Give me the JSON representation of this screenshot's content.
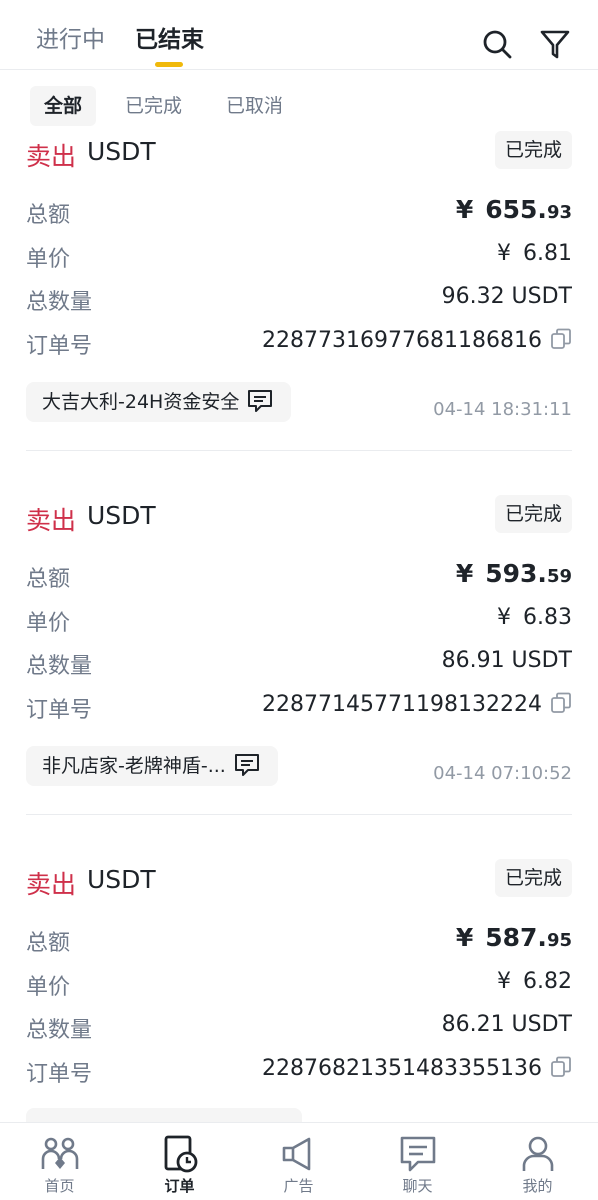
{
  "tabs": {
    "ongoing": "进行中",
    "ended": "已结束"
  },
  "filters": {
    "all": "全部",
    "completed": "已完成",
    "cancelled": "已取消"
  },
  "labels": {
    "total": "总额",
    "price": "单价",
    "quantity": "总数量",
    "order_no": "订单号",
    "currency": "¥"
  },
  "orders": [
    {
      "side": "卖出",
      "asset": "USDT",
      "status": "已完成",
      "total_int": "655.",
      "total_dec": "93",
      "price": "6.81",
      "quantity": "96.32 USDT",
      "order_no": "22877316977681186816",
      "merchant": "大吉大利-24H资金安全",
      "time": "04-14 18:31:11"
    },
    {
      "side": "卖出",
      "asset": "USDT",
      "status": "已完成",
      "total_int": "593.",
      "total_dec": "59",
      "price": "6.83",
      "quantity": "86.91 USDT",
      "order_no": "22877145771198132224",
      "merchant": "非凡店家-老牌神盾-...",
      "time": "04-14 07:10:52"
    },
    {
      "side": "卖出",
      "asset": "USDT",
      "status": "已完成",
      "total_int": "587.",
      "total_dec": "95",
      "price": "6.82",
      "quantity": "86.21 USDT",
      "order_no": "22876821351483355136"
    }
  ],
  "nav": {
    "home": "首页",
    "orders": "订单",
    "ads": "广告",
    "chat": "聊天",
    "me": "我的"
  },
  "colors": {
    "sell": "#cf304a",
    "accent": "#f0b90b",
    "muted": "#707a8a"
  }
}
